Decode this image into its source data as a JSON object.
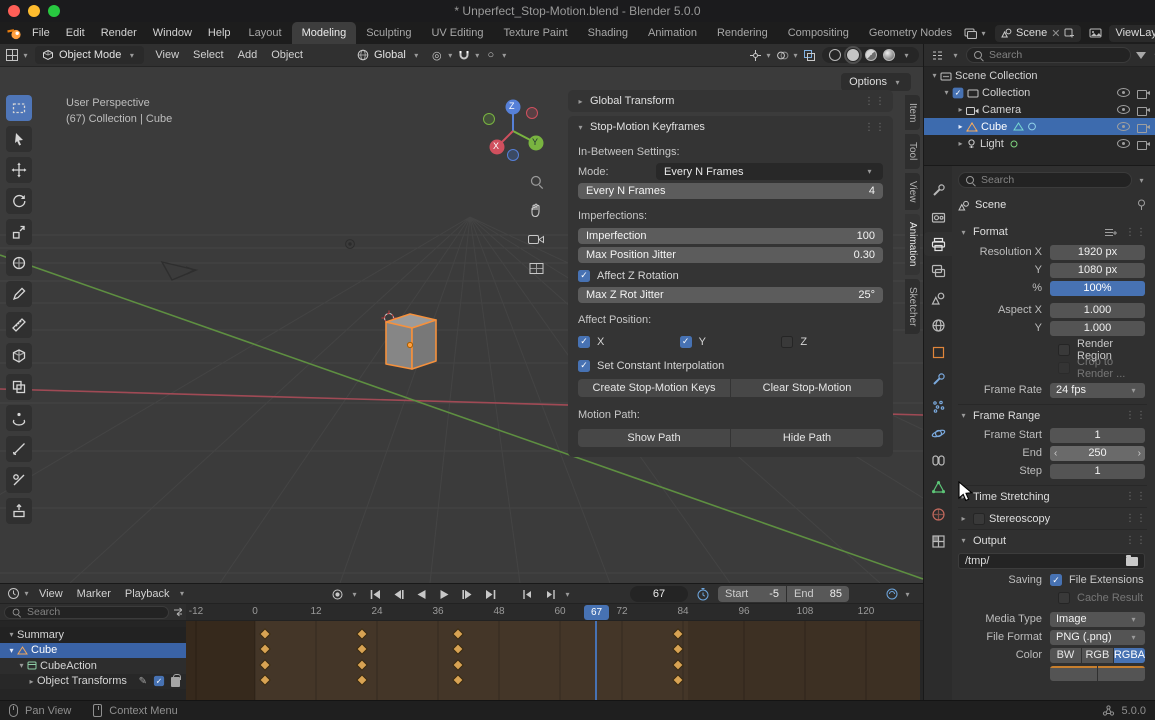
{
  "window": {
    "title": "* Unperfect_Stop-Motion.blend - Blender 5.0.0"
  },
  "topbar": {
    "menus": [
      "File",
      "Edit",
      "Render",
      "Window",
      "Help"
    ],
    "workspaces": [
      "Layout",
      "Modeling",
      "Sculpting",
      "UV Editing",
      "Texture Paint",
      "Shading",
      "Animation",
      "Rendering",
      "Compositing",
      "Geometry Nodes"
    ],
    "active_workspace": "Modeling",
    "scene_label": "Scene",
    "view_layer_label": "ViewLayer"
  },
  "viewport_header": {
    "mode": "Object Mode",
    "menus": [
      "View",
      "Select",
      "Add",
      "Object"
    ],
    "orientation": "Global",
    "options": "Options"
  },
  "viewport": {
    "perspective_label": "User Perspective",
    "context_label": "(67) Collection | Cube",
    "gizmo": {
      "x": "X",
      "y": "Y",
      "z": "Z"
    }
  },
  "sidebar_tabs": {
    "items": [
      "Item",
      "Tool",
      "View",
      "Animation",
      "Sketcher"
    ],
    "active": "Animation"
  },
  "npanel": {
    "global_transform_title": "Global Transform",
    "title": "Stop-Motion Keyframes",
    "in_between_label": "In-Between Settings:",
    "mode_label": "Mode:",
    "mode_value": "Every N Frames",
    "every_n_label": "Every N Frames",
    "every_n_value": "4",
    "imperfections_label": "Imperfections:",
    "imperfection_label": "Imperfection",
    "imperfection_value": "100",
    "max_pos_jitter_label": "Max Position Jitter",
    "max_pos_jitter_value": "0.30",
    "affect_z_rotation_label": "Affect Z Rotation",
    "max_z_rot_label": "Max Z Rot Jitter",
    "max_z_rot_value": "25°",
    "affect_position_label": "Affect Position:",
    "axis_x": "X",
    "axis_y": "Y",
    "axis_z": "Z",
    "set_constant_label": "Set Constant Interpolation",
    "create_button": "Create Stop-Motion Keys",
    "clear_button": "Clear Stop-Motion",
    "motion_path_label": "Motion Path:",
    "show_path_button": "Show Path",
    "hide_path_button": "Hide Path"
  },
  "outliner": {
    "search_placeholder": "Search",
    "items": [
      {
        "label": "Scene Collection"
      },
      {
        "label": "Collection"
      },
      {
        "label": "Camera"
      },
      {
        "label": "Cube"
      },
      {
        "label": "Light"
      }
    ]
  },
  "properties": {
    "search_placeholder": "Search",
    "breadcrumb": "Scene",
    "format": {
      "title": "Format",
      "resolution_x_label": "Resolution X",
      "resolution_x": "1920 px",
      "resolution_y_label": "Y",
      "resolution_y": "1080 px",
      "percent_label": "%",
      "percent": "100%",
      "aspect_x_label": "Aspect X",
      "aspect_x": "1.000",
      "aspect_y_label": "Y",
      "aspect_y": "1.000",
      "render_region_label": "Render Region",
      "crop_label": "Crop to Render ...",
      "frame_rate_label": "Frame Rate",
      "frame_rate": "24 fps"
    },
    "frame_range": {
      "title": "Frame Range",
      "start_label": "Frame Start",
      "start": "1",
      "end_label": "End",
      "end": "250",
      "step_label": "Step",
      "step": "1"
    },
    "time_stretching_title": "Time Stretching",
    "stereoscopy_title": "Stereoscopy",
    "output": {
      "title": "Output",
      "path": "/tmp/",
      "saving_label": "Saving",
      "file_extensions_label": "File Extensions",
      "cache_result_label": "Cache Result",
      "media_type_label": "Media Type",
      "media_type": "Image",
      "file_format_label": "File Format",
      "file_format": "PNG (.png)",
      "color_label": "Color",
      "color_options": [
        "BW",
        "RGB",
        "RGBA"
      ],
      "color_active": "RGBA"
    }
  },
  "timeline": {
    "menus": [
      "View",
      "Marker",
      "Playback"
    ],
    "current_frame": "67",
    "start_label": "Start",
    "start_value": "-5",
    "end_label": "End",
    "end_value": "85",
    "search_placeholder": "Search",
    "ruler": [
      "-12",
      "0",
      "12",
      "24",
      "36",
      "48",
      "60",
      "72",
      "84",
      "96",
      "108",
      "120"
    ],
    "channels": [
      {
        "label": "Summary"
      },
      {
        "label": "Cube"
      },
      {
        "label": "CubeAction"
      },
      {
        "label": "Object Transforms"
      }
    ],
    "keyframes": {
      "columns_x": [
        79,
        176,
        272,
        492
      ],
      "rows_y": [
        13,
        28,
        44,
        59
      ]
    }
  },
  "statusbar": {
    "hint_pan": "Pan View",
    "hint_context": "Context Menu",
    "version": "5.0.0"
  },
  "checks": {
    "affect_z_rotation": true,
    "axis_x": true,
    "axis_y": true,
    "axis_z": false,
    "set_constant": true,
    "render_region": false,
    "crop_to_render": false,
    "stereoscopy": false,
    "file_extensions": true,
    "cache_result": false,
    "collection_checkbox": true,
    "object_transforms_enabled": true
  },
  "colors": {
    "accent": "#4772b3",
    "selection_outline": "#f5913d",
    "keyframe": "#d8a353"
  }
}
